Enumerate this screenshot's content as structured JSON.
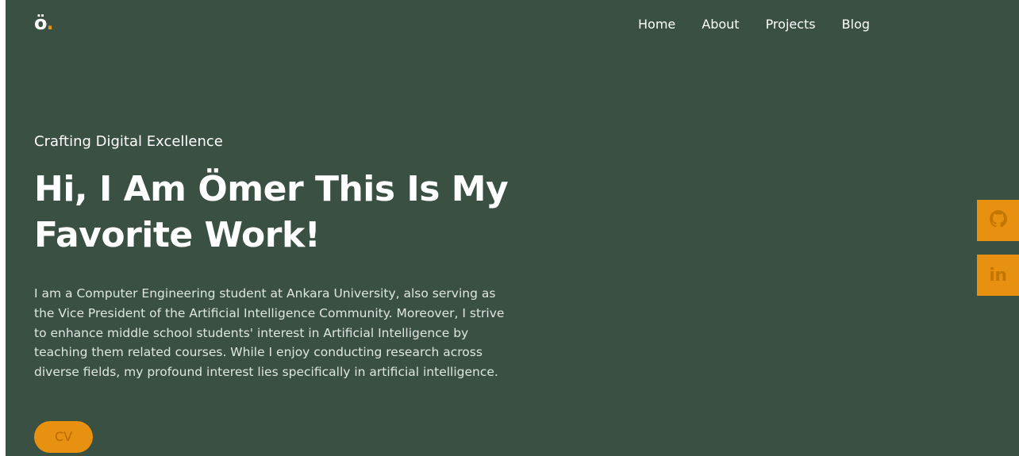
{
  "header": {
    "logo_letter": "ö",
    "logo_dot": ".",
    "nav": [
      {
        "label": "Home"
      },
      {
        "label": "About"
      },
      {
        "label": "Projects"
      },
      {
        "label": "Blog"
      }
    ]
  },
  "hero": {
    "tagline": "Crafting Digital Excellence",
    "headline": "Hi, I Am Ömer This Is My Favorite Work!",
    "bio": "I am a Computer Engineering student at Ankara University, also serving as the Vice President of the Artificial Intelligence Community. Moreover, I strive to enhance middle school students' interest in Artificial Intelligence by teaching them related courses. While I enjoy conducting research across diverse fields, my profound interest lies specifically in artificial intelligence.",
    "cv_label": "CV"
  },
  "social": {
    "linkedin_glyph": "in",
    "icons": [
      "github-icon",
      "linkedin-icon"
    ]
  },
  "colors": {
    "background": "#3a5042",
    "accent": "#e8900f",
    "text": "#ffffff"
  }
}
